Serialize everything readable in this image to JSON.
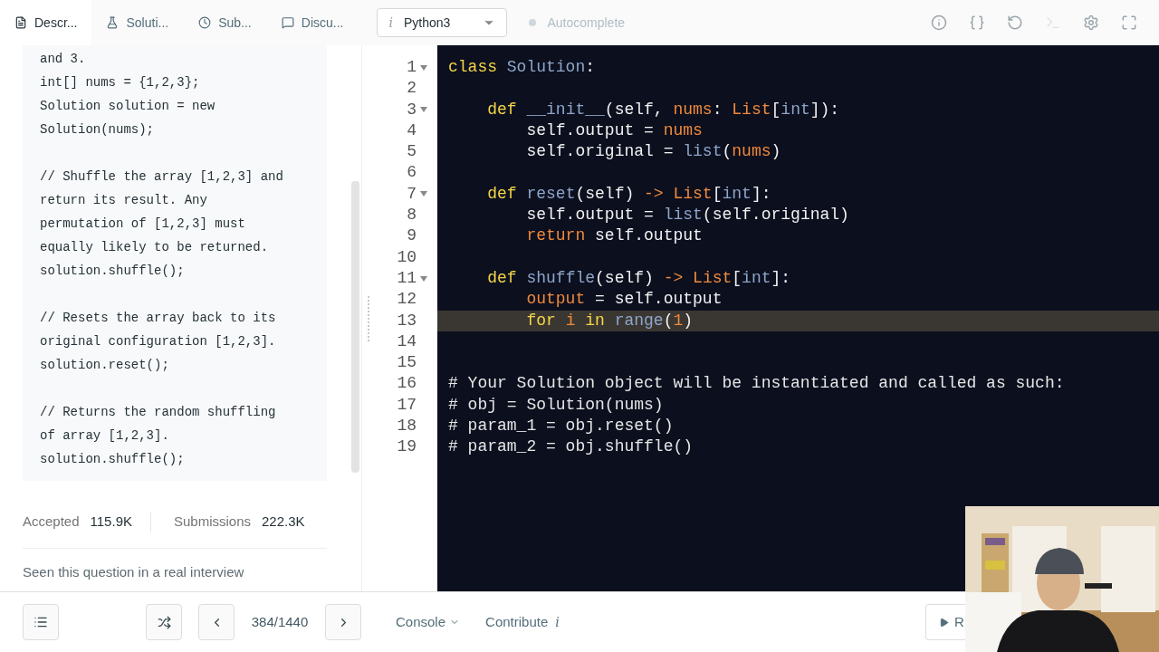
{
  "tabs": [
    {
      "label": "Descr...",
      "selected": true
    },
    {
      "label": "Soluti...",
      "selected": false
    },
    {
      "label": "Sub...",
      "selected": false
    },
    {
      "label": "Discu...",
      "selected": false
    }
  ],
  "language_select": {
    "info_glyph": "i",
    "value": "Python3"
  },
  "autocomplete": {
    "label": "Autocomplete",
    "on": false
  },
  "toolbar": [
    {
      "kind": "info",
      "disabled": false
    },
    {
      "kind": "braces",
      "disabled": false
    },
    {
      "kind": "reset",
      "disabled": false
    },
    {
      "kind": "terminal",
      "disabled": true
    },
    {
      "kind": "settings",
      "disabled": false
    },
    {
      "kind": "fullscreen",
      "disabled": false
    }
  ],
  "description_code": [
    [
      "and 3.",
      "int[] nums = {1,2,3};",
      "Solution solution = new",
      "Solution(nums);"
    ],
    [
      "// Shuffle the array [1,2,3] and",
      "return its result. Any",
      "permutation of [1,2,3] must",
      "equally likely to be returned.",
      "solution.shuffle();"
    ],
    [
      "// Resets the array back to its",
      "original configuration [1,2,3].",
      "solution.reset();"
    ],
    [
      "// Returns the random shuffling",
      "of array [1,2,3].",
      "solution.shuffle();"
    ]
  ],
  "stats": [
    {
      "label": "Accepted",
      "value": "115.9K"
    },
    {
      "label": "Submissions",
      "value": "222.3K"
    }
  ],
  "interview_link": "Seen this question in a real interview",
  "code_lines": [
    {
      "number": "1",
      "foldable": true,
      "active": false,
      "tokens": [
        {
          "t": "class ",
          "kind": "keyword"
        },
        {
          "t": "Solution",
          "kind": "name"
        },
        {
          "t": ":",
          "kind": "plain"
        }
      ]
    },
    {
      "number": "2",
      "foldable": false,
      "active": false
    },
    {
      "number": "3",
      "foldable": true,
      "active": false,
      "tokens": [
        {
          "t": "    def ",
          "kind": "keyword"
        },
        {
          "t": "__init__",
          "kind": "name"
        },
        {
          "t": "(self, ",
          "kind": "plain"
        },
        {
          "t": "nums",
          "kind": "variable"
        },
        {
          "t": ": ",
          "kind": "plain"
        },
        {
          "t": "List",
          "kind": "variable"
        },
        {
          "t": "[",
          "kind": "plain"
        },
        {
          "t": "int",
          "kind": "name"
        },
        {
          "t": "]):",
          "kind": "plain"
        }
      ]
    },
    {
      "number": "4",
      "foldable": false,
      "active": false,
      "tokens": [
        {
          "t": "        self.output = ",
          "kind": "plain"
        },
        {
          "t": "nums",
          "kind": "variable"
        }
      ]
    },
    {
      "number": "5",
      "foldable": false,
      "active": false,
      "tokens": [
        {
          "t": "        self.original = ",
          "kind": "plain"
        },
        {
          "t": "list",
          "kind": "name"
        },
        {
          "t": "(",
          "kind": "plain"
        },
        {
          "t": "nums",
          "kind": "variable"
        },
        {
          "t": ")",
          "kind": "plain"
        }
      ]
    },
    {
      "number": "6",
      "foldable": false,
      "active": false
    },
    {
      "number": "7",
      "foldable": true,
      "active": false,
      "tokens": [
        {
          "t": "    def ",
          "kind": "keyword"
        },
        {
          "t": "reset",
          "kind": "name"
        },
        {
          "t": "(self) ",
          "kind": "plain"
        },
        {
          "t": "-> List",
          "kind": "variable"
        },
        {
          "t": "[",
          "kind": "plain"
        },
        {
          "t": "int",
          "kind": "name"
        },
        {
          "t": "]:",
          "kind": "plain"
        }
      ]
    },
    {
      "number": "8",
      "foldable": false,
      "active": false,
      "tokens": [
        {
          "t": "        self.output = ",
          "kind": "plain"
        },
        {
          "t": "list",
          "kind": "name"
        },
        {
          "t": "(self.original)",
          "kind": "plain"
        }
      ]
    },
    {
      "number": "9",
      "foldable": false,
      "active": false,
      "tokens": [
        {
          "t": "        return",
          "kind": "variable"
        },
        {
          "t": " self.output",
          "kind": "plain"
        }
      ]
    },
    {
      "number": "10",
      "foldable": false,
      "active": false
    },
    {
      "number": "11",
      "foldable": true,
      "active": false,
      "tokens": [
        {
          "t": "    def ",
          "kind": "keyword"
        },
        {
          "t": "shuffle",
          "kind": "name"
        },
        {
          "t": "(self) ",
          "kind": "plain"
        },
        {
          "t": "-> List",
          "kind": "variable"
        },
        {
          "t": "[",
          "kind": "plain"
        },
        {
          "t": "int",
          "kind": "name"
        },
        {
          "t": "]:",
          "kind": "plain"
        }
      ]
    },
    {
      "number": "12",
      "foldable": false,
      "active": false,
      "tokens": [
        {
          "t": "        output",
          "kind": "variable"
        },
        {
          "t": " = self.output",
          "kind": "plain"
        }
      ]
    },
    {
      "number": "13",
      "foldable": false,
      "active": true,
      "tokens": [
        {
          "t": "        for ",
          "kind": "keyword"
        },
        {
          "t": "i ",
          "kind": "variable"
        },
        {
          "t": "in ",
          "kind": "keyword"
        },
        {
          "t": "range",
          "kind": "name"
        },
        {
          "t": "(",
          "kind": "plain"
        },
        {
          "t": "1",
          "kind": "variable"
        },
        {
          "t": ")",
          "kind": "plain"
        }
      ]
    },
    {
      "number": "14",
      "foldable": false,
      "active": false
    },
    {
      "number": "15",
      "foldable": false,
      "active": false
    },
    {
      "number": "16",
      "foldable": false,
      "active": false,
      "tokens": [
        {
          "t": "# Your Solution object will be instantiated and called as such:",
          "kind": "comment"
        }
      ]
    },
    {
      "number": "17",
      "foldable": false,
      "active": false,
      "tokens": [
        {
          "t": "# obj = Solution(nums)",
          "kind": "comment"
        }
      ]
    },
    {
      "number": "18",
      "foldable": false,
      "active": false,
      "tokens": [
        {
          "t": "# param_1 = obj.reset()",
          "kind": "comment"
        }
      ]
    },
    {
      "number": "19",
      "foldable": false,
      "active": false,
      "tokens": [
        {
          "t": "# param_2 = obj.shuffle()",
          "kind": "comment"
        }
      ]
    }
  ],
  "pager": "384/1440",
  "console": "Console",
  "contribute": {
    "label": "Contribute",
    "info_glyph": "i"
  },
  "run_button": "R",
  "webcam": {
    "kind": "picture"
  }
}
